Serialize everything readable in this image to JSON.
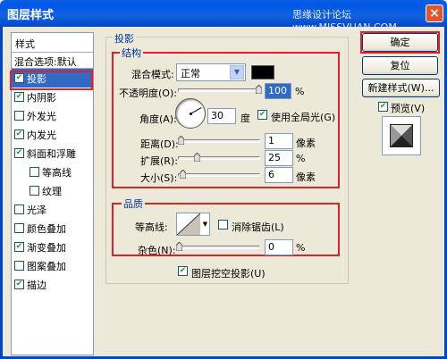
{
  "window": {
    "title": "图层样式",
    "watermark": "思缘设计论坛 www.MISSVUAN.COM",
    "close_glyph": "×"
  },
  "sidebar": {
    "header": "样式",
    "blend_options": "混合选项:默认",
    "items": [
      {
        "label": "投影",
        "checked": true,
        "selected": true
      },
      {
        "label": "内阴影",
        "checked": true
      },
      {
        "label": "外发光",
        "checked": false
      },
      {
        "label": "内发光",
        "checked": true
      },
      {
        "label": "斜面和浮雕",
        "checked": true
      },
      {
        "label": "等高线",
        "checked": false,
        "indent": true
      },
      {
        "label": "纹理",
        "checked": false,
        "indent": true
      },
      {
        "label": "光泽",
        "checked": false
      },
      {
        "label": "颜色叠加",
        "checked": false
      },
      {
        "label": "渐变叠加",
        "checked": true
      },
      {
        "label": "图案叠加",
        "checked": false
      },
      {
        "label": "描边",
        "checked": true
      }
    ]
  },
  "drop_shadow": {
    "section_title": "投影",
    "structure": {
      "title": "结构",
      "blend_mode_label": "混合模式:",
      "blend_mode_value": "正常",
      "shadow_color": "#000000",
      "opacity_label": "不透明度(O):",
      "opacity_value": "100",
      "opacity_unit": "%",
      "angle_label": "角度(A):",
      "angle_value": "30",
      "angle_unit": "度",
      "global_light_label": "使用全局光(G)",
      "global_light_checked": true,
      "distance_label": "距离(D):",
      "distance_value": "1",
      "distance_unit": "像素",
      "spread_label": "扩展(R):",
      "spread_value": "25",
      "spread_unit": "%",
      "size_label": "大小(S):",
      "size_value": "6",
      "size_unit": "像素"
    },
    "quality": {
      "title": "品质",
      "contour_label": "等高线:",
      "antialias_label": "消除锯齿(L)",
      "antialias_checked": false,
      "noise_label": "杂色(N):",
      "noise_value": "0",
      "noise_unit": "%"
    },
    "knockout_label": "图层挖空投影(U)",
    "knockout_checked": true
  },
  "buttons": {
    "ok": "确定",
    "reset": "复位",
    "new_style": "新建样式(W)...",
    "preview_label": "预览(V)",
    "preview_checked": true
  },
  "check_glyph": "✔",
  "dropdown_glyph": "▼"
}
